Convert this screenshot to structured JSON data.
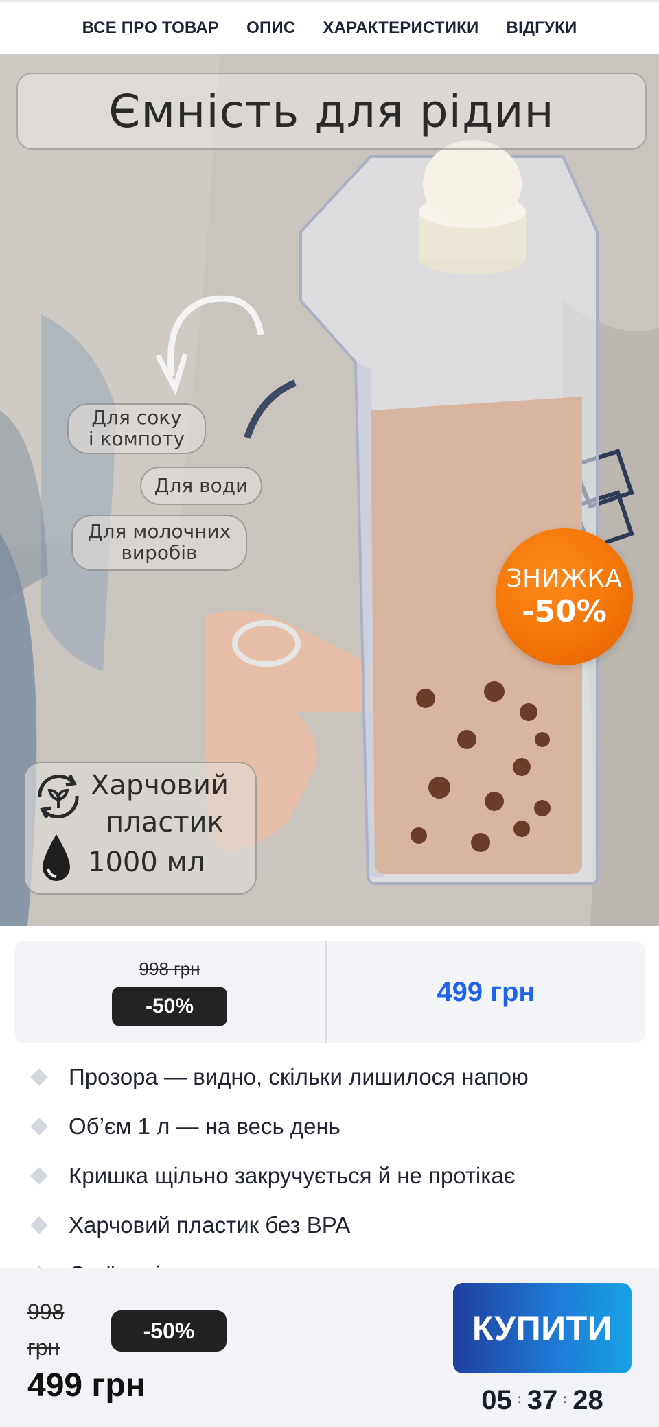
{
  "nav": {
    "items": [
      {
        "label": "ВСЕ ПРО ТОВАР"
      },
      {
        "label": "ОПИС"
      },
      {
        "label": "ХАРАКТЕРИСТИКИ"
      },
      {
        "label": "ВІДГУКИ"
      }
    ]
  },
  "hero": {
    "title": "Ємність для рідин",
    "uses": {
      "juice": "Для соку\nі компоту",
      "water": "Для води",
      "dairy": "Для молочних\nвиробів"
    },
    "discount": {
      "label": "ЗНИЖКА",
      "value": "-50%",
      "color": "#f37507"
    },
    "specs": {
      "line1": "Харчовий",
      "line2": "пластик",
      "line3": "1000 мл",
      "icons": [
        "eco-plastic-icon",
        "water-drop-icon"
      ]
    }
  },
  "price": {
    "old": "998 грн",
    "badge": "-50%",
    "new": "499 грн",
    "new_color": "#1f63e6"
  },
  "features": [
    "Прозора — видно, скільки лишилося напою",
    "Об’єм 1 л — на весь день",
    "Кришка щільно закручується й не протікає",
    "Харчовий пластик без BPA",
    "Стоїть рівно в дверцятах холодильника"
  ],
  "bottom_bar": {
    "old_price": "998 грн",
    "badge": "-50%",
    "new_price": "499 грн",
    "buy_label": "КУПИТИ",
    "timer": {
      "hours": "05",
      "minutes": "37",
      "seconds": "28",
      "separator": ":"
    }
  }
}
